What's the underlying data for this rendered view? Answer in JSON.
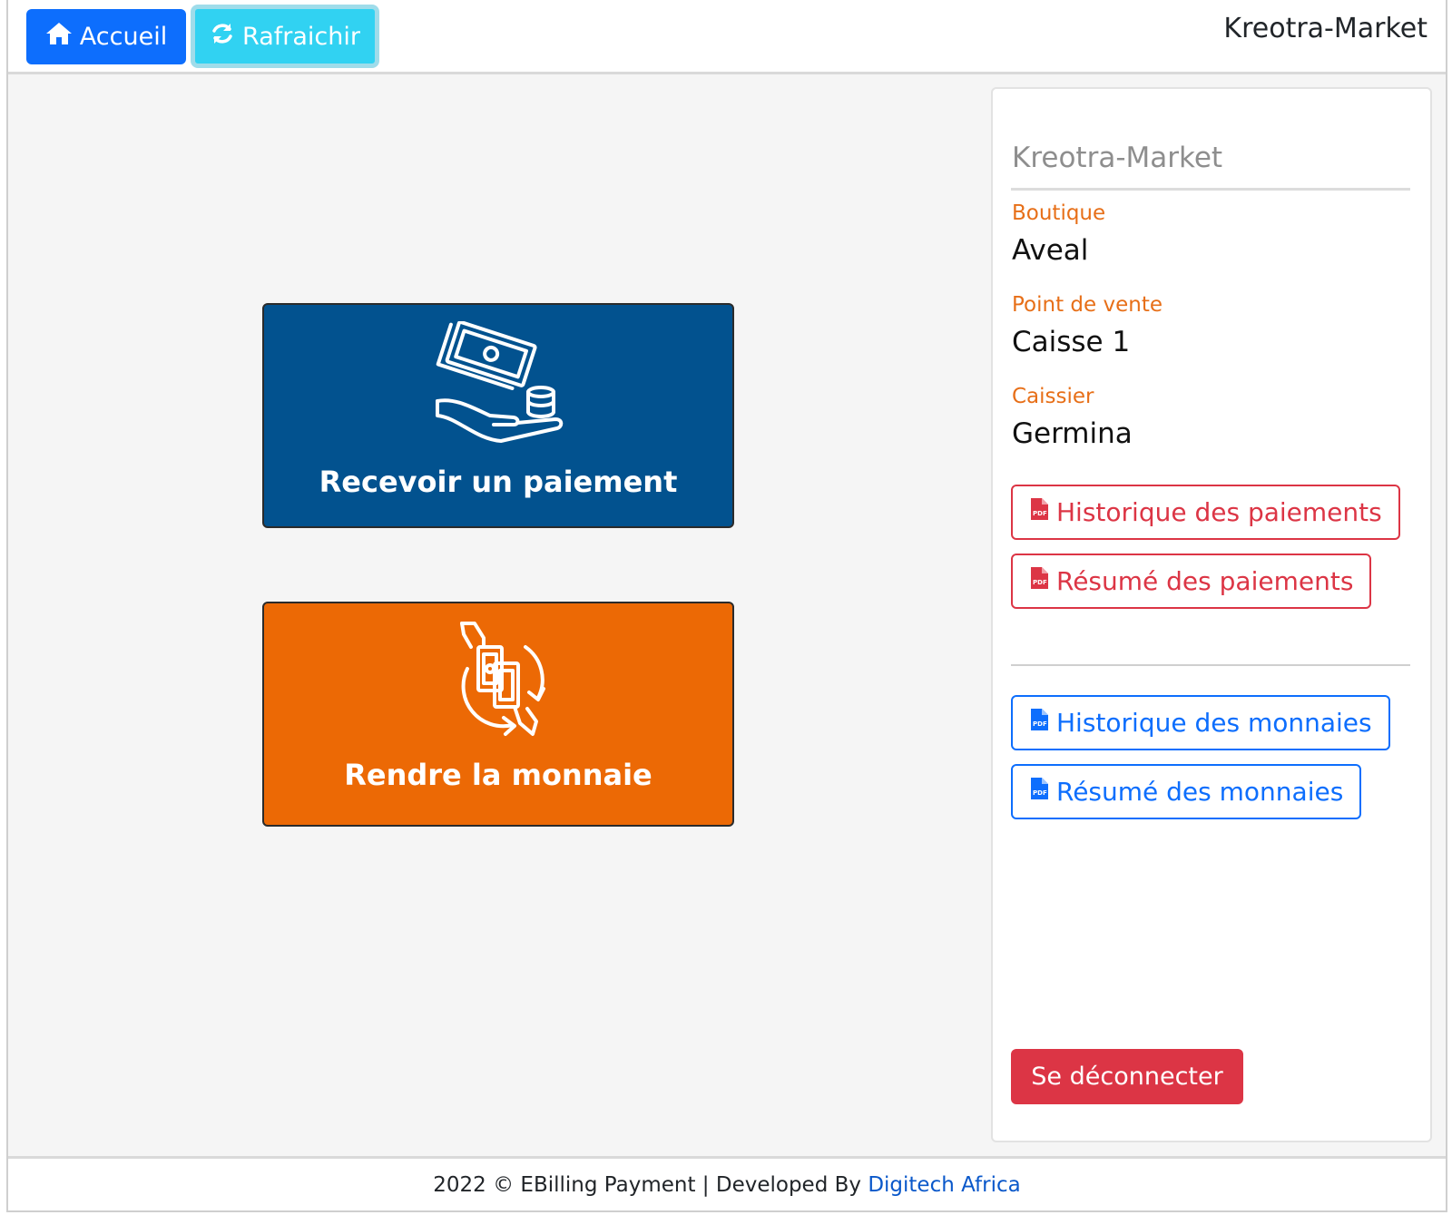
{
  "header": {
    "home_label": "Accueil",
    "refresh_label": "Rafraichir",
    "brand": "Kreotra-Market"
  },
  "tiles": {
    "receive_label": "Recevoir un paiement",
    "change_label": "Rendre la monnaie"
  },
  "sidebar": {
    "title": "Kreotra-Market",
    "shop_label": "Boutique",
    "shop_value": "Aveal",
    "pos_label": "Point de vente",
    "pos_value": "Caisse 1",
    "cashier_label": "Caissier",
    "cashier_value": "Germina",
    "payments_history": "Historique des paiements",
    "payments_summary": "Résumé des paiements",
    "change_history": "Historique des monnaies",
    "change_summary": "Résumé des monnaies",
    "logout": "Se déconnecter"
  },
  "footer": {
    "text": "2022 © EBilling Payment | Developed By",
    "link": "Digitech Africa"
  },
  "colors": {
    "primary": "#0d6efd",
    "info": "#31d2f2",
    "danger": "#dc3545",
    "tile_blue": "#02528f",
    "tile_orange": "#ec6905",
    "label_orange": "#e76f18"
  }
}
